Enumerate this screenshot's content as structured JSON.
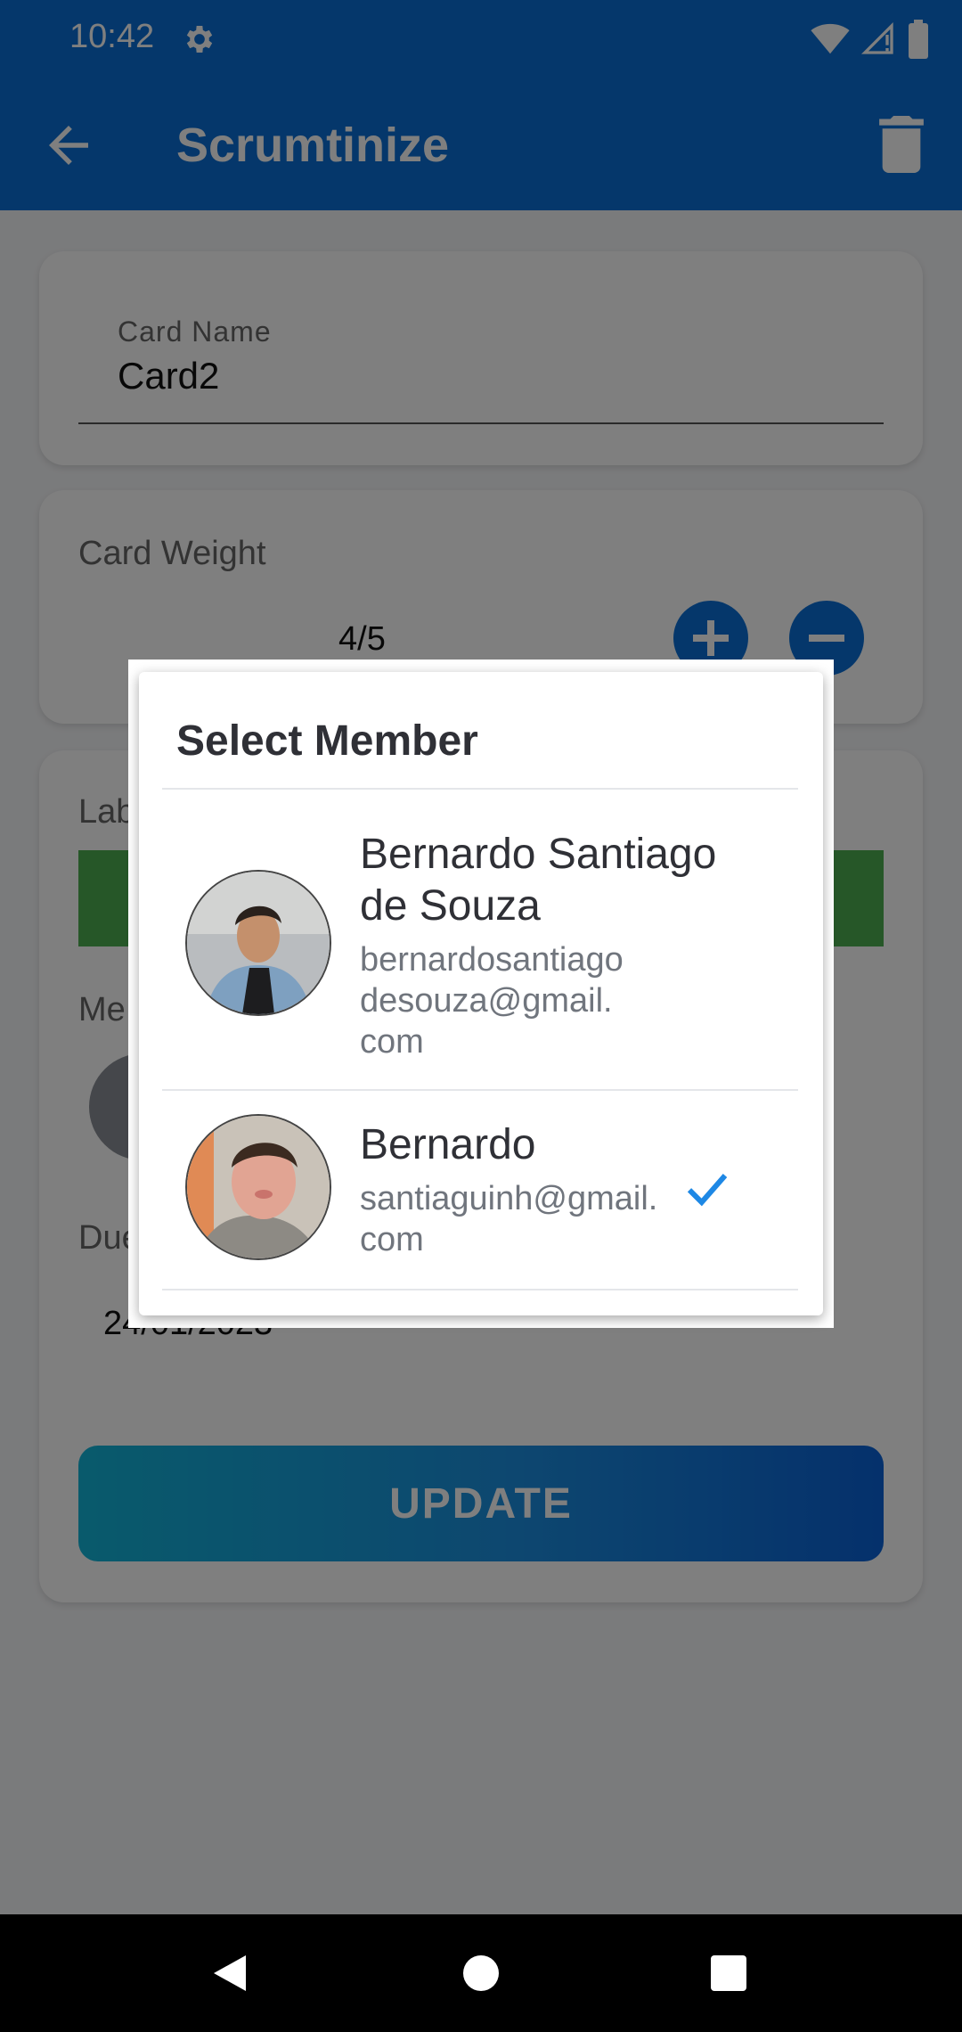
{
  "status_bar": {
    "time": "10:42",
    "icons": [
      "gear-icon",
      "wifi-icon",
      "signal-icon",
      "battery-icon"
    ]
  },
  "app_bar": {
    "title": "Scrumtinize",
    "back_icon": "arrow-back-icon",
    "action_icon": "trash-icon"
  },
  "card_name": {
    "label": "Card Name",
    "value": "Card2"
  },
  "card_weight": {
    "label": "Card Weight",
    "value": "4/5"
  },
  "labels_section": {
    "label": "Lab"
  },
  "members_section": {
    "label": "Me"
  },
  "due_section": {
    "label": "Due",
    "value": "24/01/2023"
  },
  "update_button": {
    "label": "UPDATE"
  },
  "dialog": {
    "title": "Select Member",
    "members": [
      {
        "name": "Bernardo Santiago de Souza",
        "email": "bernardosantiagodesouza@gmail.com",
        "selected": false
      },
      {
        "name": "Bernardo",
        "email": "santiaguinh@gmail.com",
        "selected": true
      }
    ]
  },
  "colors": {
    "primary": "#0a6fd6",
    "label_green": "#4caf50",
    "check": "#1e88e5"
  }
}
